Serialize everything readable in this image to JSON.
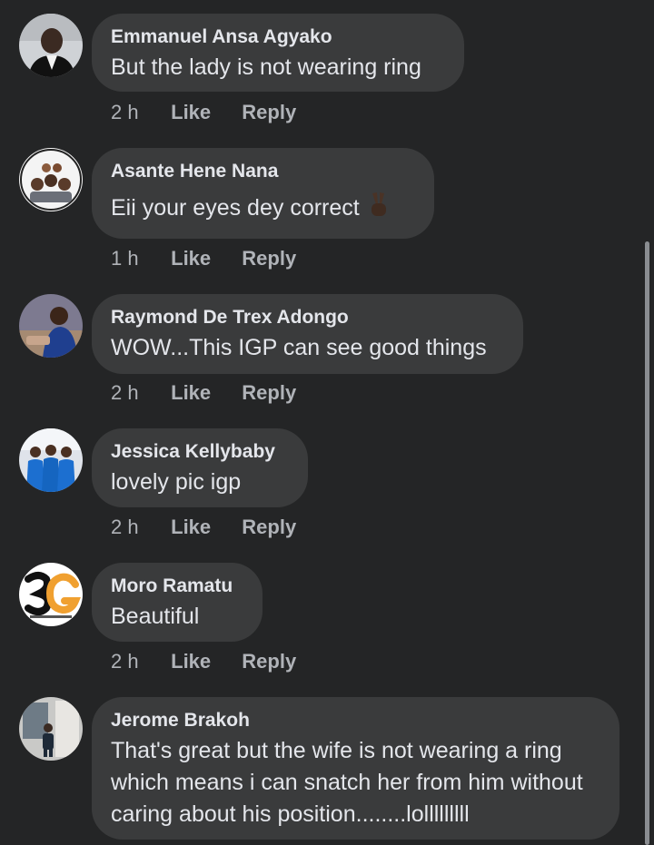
{
  "comments": [
    {
      "author": "Emmanuel Ansa Agyako",
      "text": "But the lady is not wearing ring",
      "time": "2 h",
      "like": "Like",
      "reply": "Reply",
      "avatar_icon": "person-photo-avatar"
    },
    {
      "author": "Asante Hene Nana",
      "text": "Eii your eyes dey correct",
      "emoji": "✌🏿",
      "time": "1 h",
      "like": "Like",
      "reply": "Reply",
      "avatar_icon": "group-photo-avatar"
    },
    {
      "author": "Raymond De Trex Adongo",
      "text": "WOW...This IGP can see good things",
      "time": "2 h",
      "like": "Like",
      "reply": "Reply",
      "avatar_icon": "person-photo-avatar"
    },
    {
      "author": "Jessica Kellybaby",
      "text": "lovely pic igp",
      "time": "2 h",
      "like": "Like",
      "reply": "Reply",
      "avatar_icon": "group-photo-avatar"
    },
    {
      "author": "Moro Ramatu",
      "text": "Beautiful",
      "time": "2 h",
      "like": "Like",
      "reply": "Reply",
      "avatar_icon": "logo-avatar"
    },
    {
      "author": "Jerome Brakoh",
      "text": "That's great but the wife is not wearing a ring which means i can snatch her from him without caring about his position........lolllllllll",
      "avatar_icon": "person-photo-avatar"
    }
  ],
  "colors": {
    "background": "#242526",
    "bubble": "#3a3b3c",
    "text_primary": "#e4e6eb",
    "text_secondary": "#b0b3b8"
  }
}
